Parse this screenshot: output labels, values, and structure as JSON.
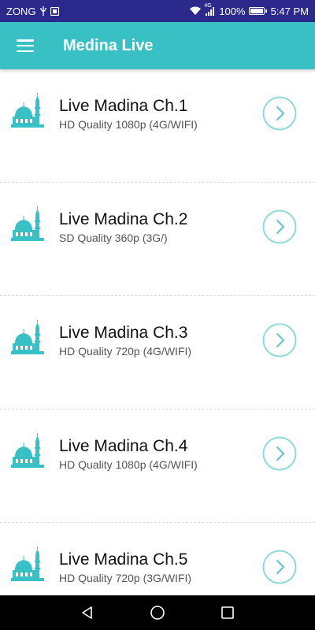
{
  "status_bar": {
    "carrier": "ZONG",
    "network_label": "4G",
    "battery": "100%",
    "battery_level": 1.0,
    "time": "5:47 PM",
    "icons": [
      "usb-icon",
      "sim-icon",
      "wifi-icon",
      "signal-icon",
      "battery-icon"
    ]
  },
  "app_bar": {
    "title": "Medina Live",
    "menu_icon": "hamburger-icon"
  },
  "channels": [
    {
      "title": "Live Madina Ch.1",
      "subtitle": "HD Quality 1080p (4G/WIFI)"
    },
    {
      "title": "Live Madina Ch.2",
      "subtitle": "SD Quality 360p (3G/)"
    },
    {
      "title": "Live Madina Ch.3",
      "subtitle": "HD Quality 720p (4G/WIFI)"
    },
    {
      "title": "Live Madina Ch.4",
      "subtitle": "HD Quality 1080p (4G/WIFI)"
    },
    {
      "title": "Live Madina Ch.5",
      "subtitle": "HD Quality 720p (3G/WIFI)"
    }
  ],
  "nav_bar": {
    "icons": [
      "back-icon",
      "home-icon",
      "recents-icon"
    ]
  },
  "colors": {
    "status_bar_bg": "#2b2a8c",
    "app_bar_bg": "#39c0c4",
    "accent": "#39c0c4",
    "nav_bar_bg": "#000000"
  }
}
